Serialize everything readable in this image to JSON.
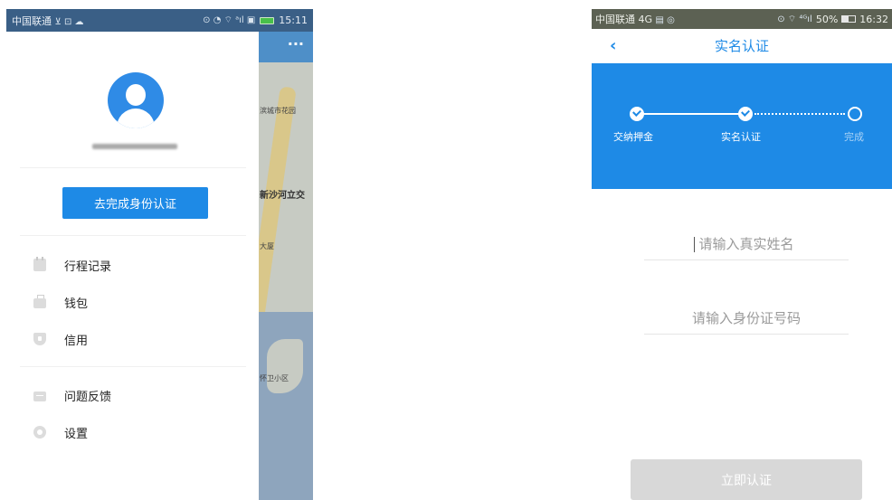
{
  "left_screen": {
    "statusbar": {
      "carrier": "中国联通",
      "carrier_icons": "⊻ ⊡ ☁",
      "status_icons": "⊙ ◔ ⌔ ᵃıl ▣",
      "time": "15:11"
    },
    "map": {
      "menu_dots": "···",
      "labels": [
        "滨城市花园",
        "新沙河立交",
        "大厦",
        "怀卫小区"
      ]
    },
    "drawer": {
      "auth_button": "去完成身份认证",
      "menu": [
        {
          "icon": "calendar-icon",
          "label": "行程记录"
        },
        {
          "icon": "wallet-icon",
          "label": "钱包"
        },
        {
          "icon": "shield-icon",
          "label": "信用"
        },
        {
          "icon": "message-icon",
          "label": "问题反馈"
        },
        {
          "icon": "gear-icon",
          "label": "设置"
        }
      ]
    },
    "colors": {
      "accent": "#1e8ae6",
      "statusbar": "#3a5f86"
    }
  },
  "right_screen": {
    "statusbar": {
      "carrier": "中国联通 4G",
      "carrier_icons": "▤ ◎",
      "status_icons": "⊙ ⌔ ⁴ᴳıl",
      "battery": "50%",
      "time": "16:32"
    },
    "nav": {
      "back": "‹",
      "title": "实名认证"
    },
    "steps": [
      {
        "label": "交纳押金",
        "state": "done"
      },
      {
        "label": "实名认证",
        "state": "done"
      },
      {
        "label": "完成",
        "state": "todo"
      }
    ],
    "form": {
      "name_placeholder": "请输入真实姓名",
      "id_placeholder": "请输入身份证号码",
      "submit_label": "立即认证"
    },
    "colors": {
      "accent": "#1e8ae6",
      "disabled_button": "#d8d8d8"
    }
  }
}
